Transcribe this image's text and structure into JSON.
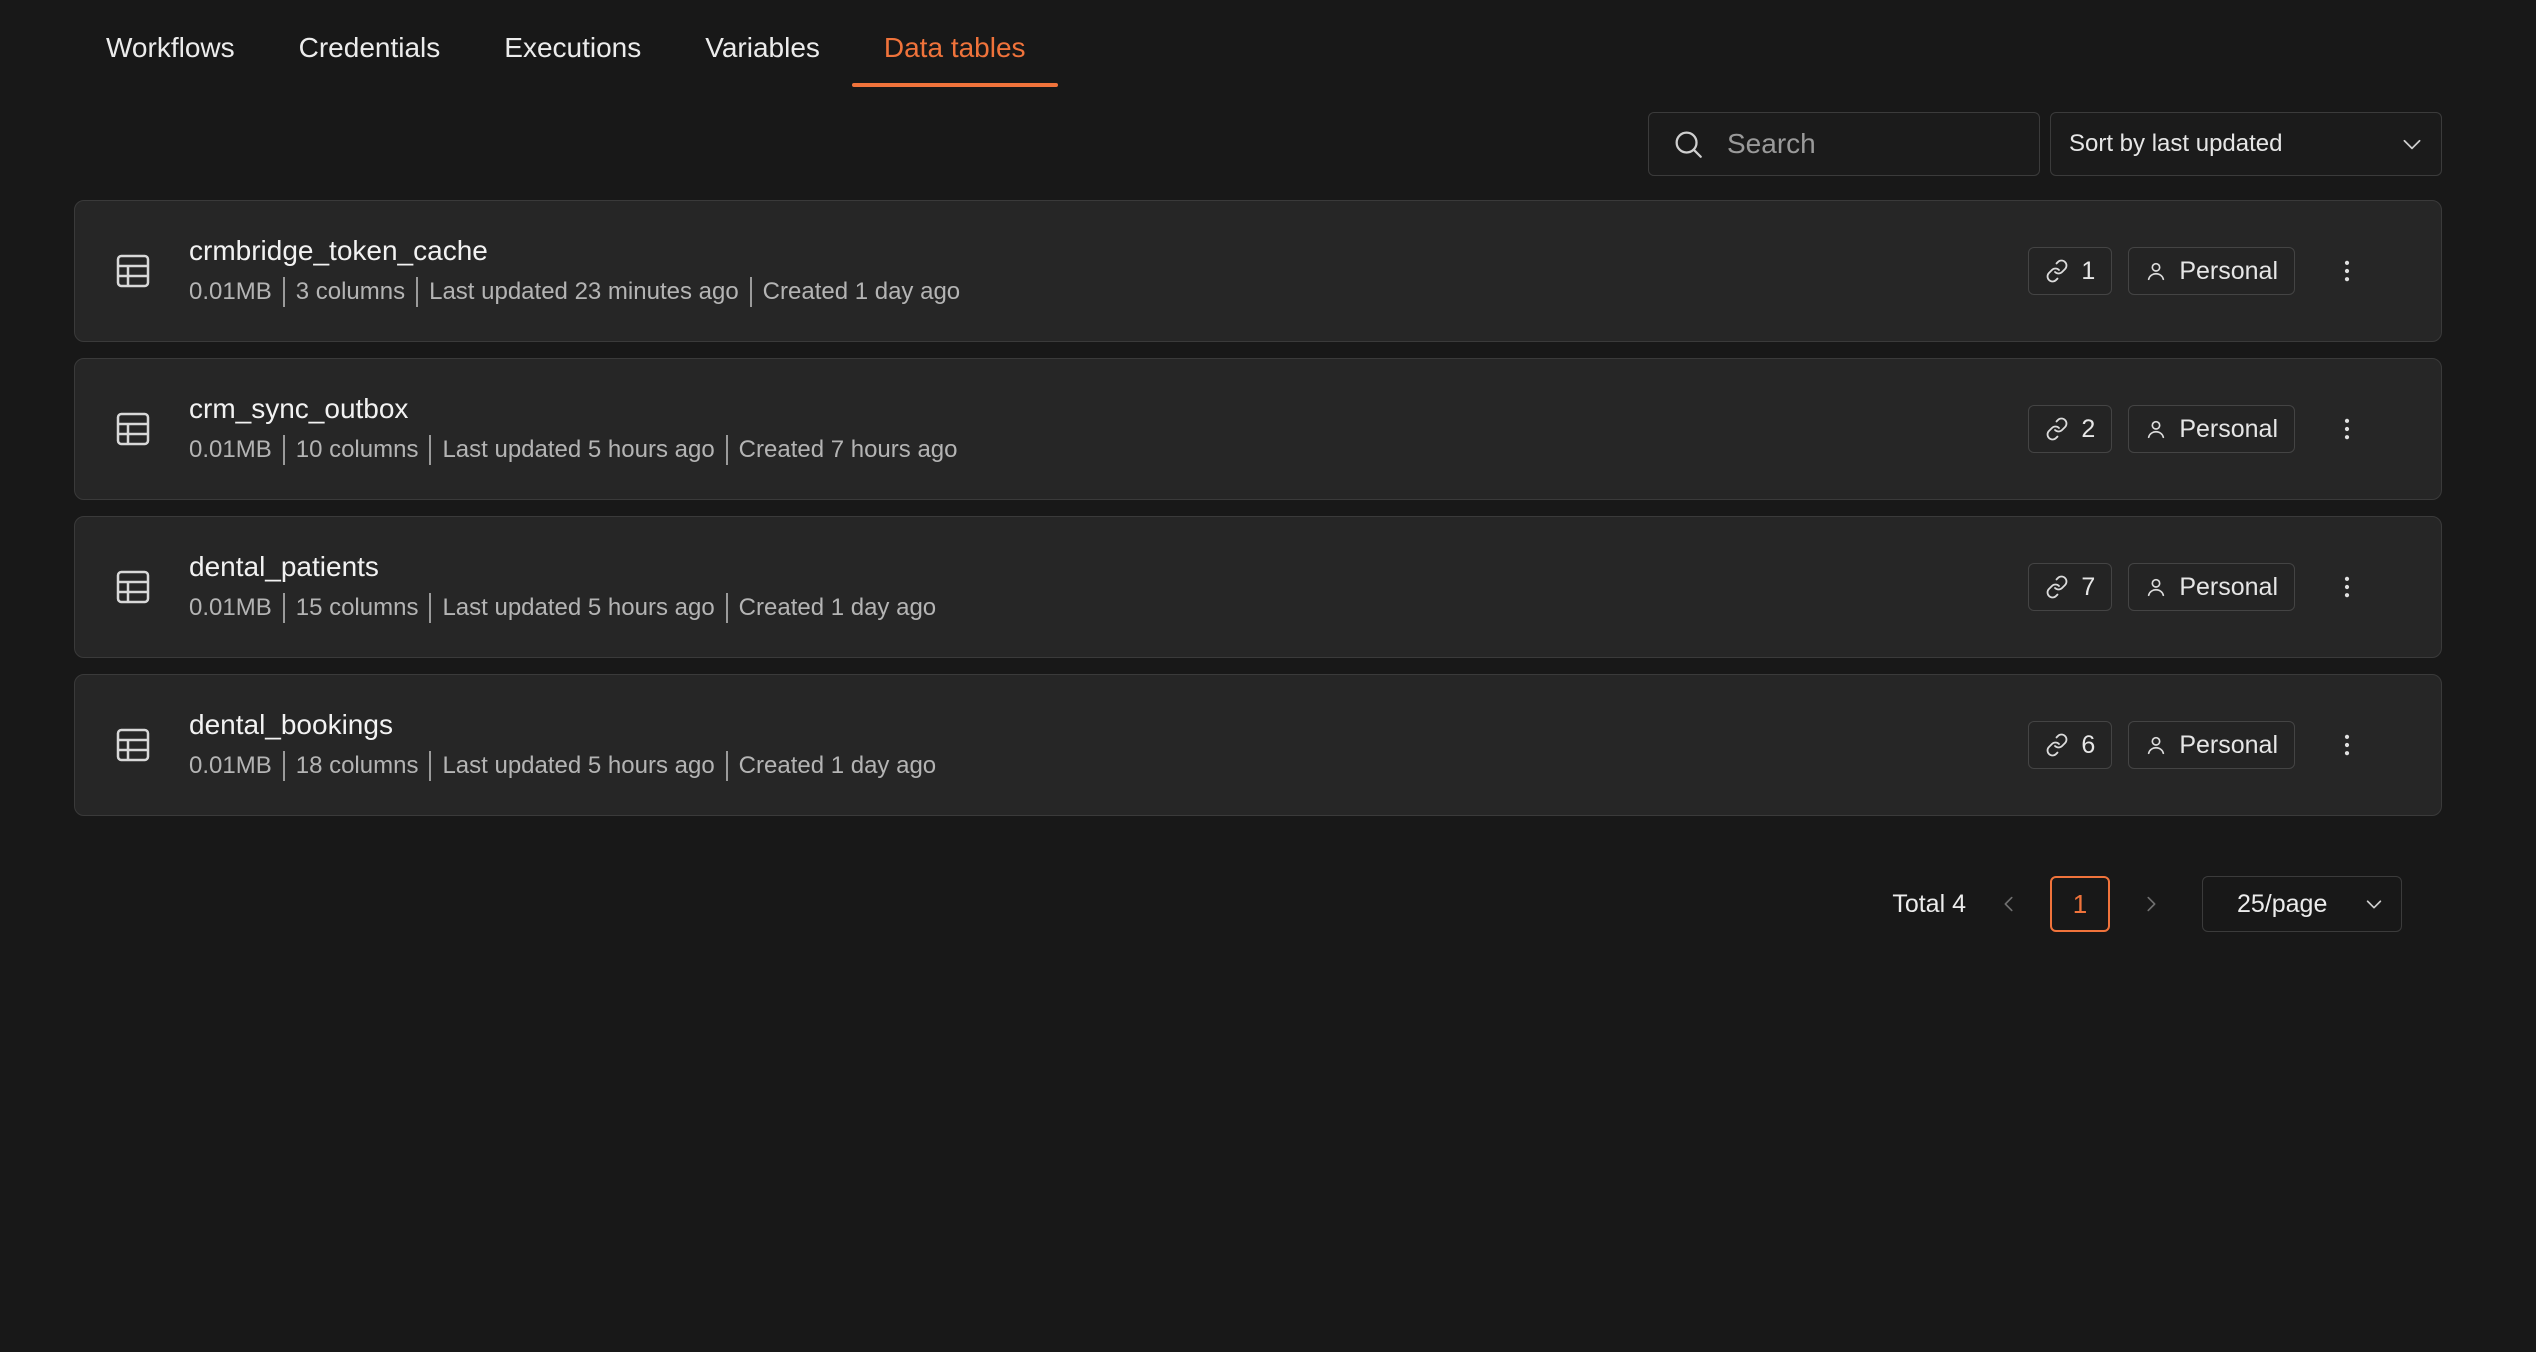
{
  "tabs": [
    {
      "label": "Workflows",
      "active": false
    },
    {
      "label": "Credentials",
      "active": false
    },
    {
      "label": "Executions",
      "active": false
    },
    {
      "label": "Variables",
      "active": false
    },
    {
      "label": "Data tables",
      "active": true
    }
  ],
  "toolbar": {
    "search_placeholder": "Search",
    "search_value": "",
    "sort_label": "Sort by last updated"
  },
  "tables": [
    {
      "name": "crmbridge_token_cache",
      "size": "0.01MB",
      "columns": "3 columns",
      "updated": "Last updated 23 minutes ago",
      "created": "Created 1 day ago",
      "links": "1",
      "owner": "Personal"
    },
    {
      "name": "crm_sync_outbox",
      "size": "0.01MB",
      "columns": "10 columns",
      "updated": "Last updated 5 hours ago",
      "created": "Created 7 hours ago",
      "links": "2",
      "owner": "Personal"
    },
    {
      "name": "dental_patients",
      "size": "0.01MB",
      "columns": "15 columns",
      "updated": "Last updated 5 hours ago",
      "created": "Created 1 day ago",
      "links": "7",
      "owner": "Personal"
    },
    {
      "name": "dental_bookings",
      "size": "0.01MB",
      "columns": "18 columns",
      "updated": "Last updated 5 hours ago",
      "created": "Created 1 day ago",
      "links": "6",
      "owner": "Personal"
    }
  ],
  "pagination": {
    "total_label": "Total 4",
    "current_page": "1",
    "page_size": "25/page"
  },
  "colors": {
    "accent": "#f0733b",
    "background": "#181818",
    "card": "#262626"
  },
  "icons": [
    "search-icon",
    "chevron-down-icon",
    "table-icon",
    "link-icon",
    "user-icon",
    "more-vertical-icon",
    "chevron-left-icon",
    "chevron-right-icon"
  ]
}
